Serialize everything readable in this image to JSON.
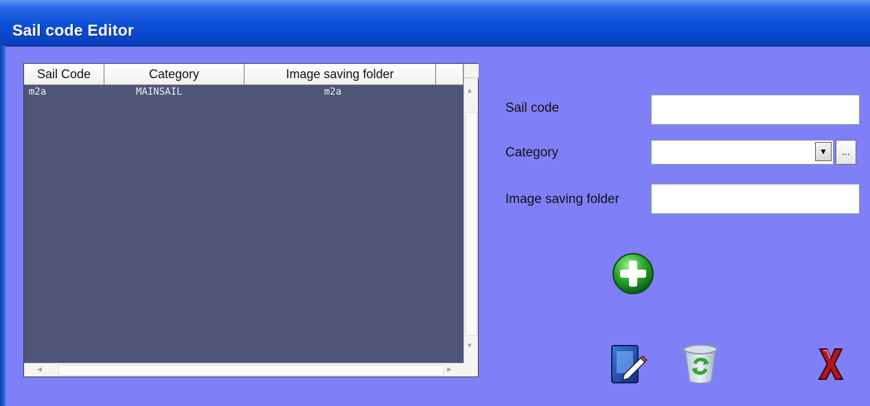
{
  "window": {
    "title": "Sail code Editor"
  },
  "list": {
    "columns": [
      "Sail Code",
      "Category",
      "Image saving folder"
    ],
    "rows": [
      {
        "sail_code": "m2a",
        "category": "MAINSAIL",
        "folder": "m2a"
      }
    ]
  },
  "form": {
    "sail_code_label": "Sail code",
    "sail_code_value": "",
    "category_label": "Category",
    "category_value": "",
    "category_browse_label": "...",
    "folder_label": "Image saving folder",
    "folder_value": ""
  },
  "icons": {
    "add": "plus-circle-icon",
    "edit": "edit-pencil-icon",
    "delete": "recycle-bin-icon",
    "close": "red-x-icon"
  },
  "colors": {
    "background": "#7f7ff7",
    "list_background": "#4e5577",
    "title_bar": "#0b4fd9"
  }
}
